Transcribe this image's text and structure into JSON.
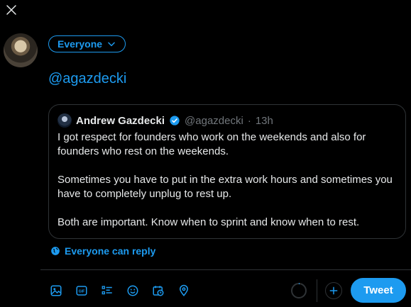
{
  "icons": {
    "close": "close-icon",
    "chevron": "chevron-down-icon",
    "verified": "verified-badge-icon",
    "globe": "globe-icon",
    "media": "image-icon",
    "gif": "gif-icon",
    "poll": "poll-icon",
    "emoji": "emoji-icon",
    "schedule": "schedule-icon",
    "location": "location-icon",
    "add": "plus-icon"
  },
  "composer": {
    "audience_label": "Everyone",
    "text": "@agazdecki"
  },
  "quote": {
    "name": "Andrew Gazdecki",
    "handle": "@agazdecki",
    "separator": "·",
    "time": "13h",
    "paragraphs": [
      "I got respect for founders who work on the weekends and also for founders who rest on the weekends.",
      "Sometimes you have to put in the extra work hours and sometimes you have to completely unplug to rest up.",
      "Both are important. Know when to sprint and know when to rest."
    ]
  },
  "reply_setting": "Everyone can reply",
  "toolbar": {
    "gif_text": "GIF",
    "tweet_label": "Tweet"
  },
  "colors": {
    "accent": "#1d9bf0",
    "background": "#000000",
    "border": "#2f3336",
    "text": "#e7e9ea",
    "muted": "#71767b"
  }
}
